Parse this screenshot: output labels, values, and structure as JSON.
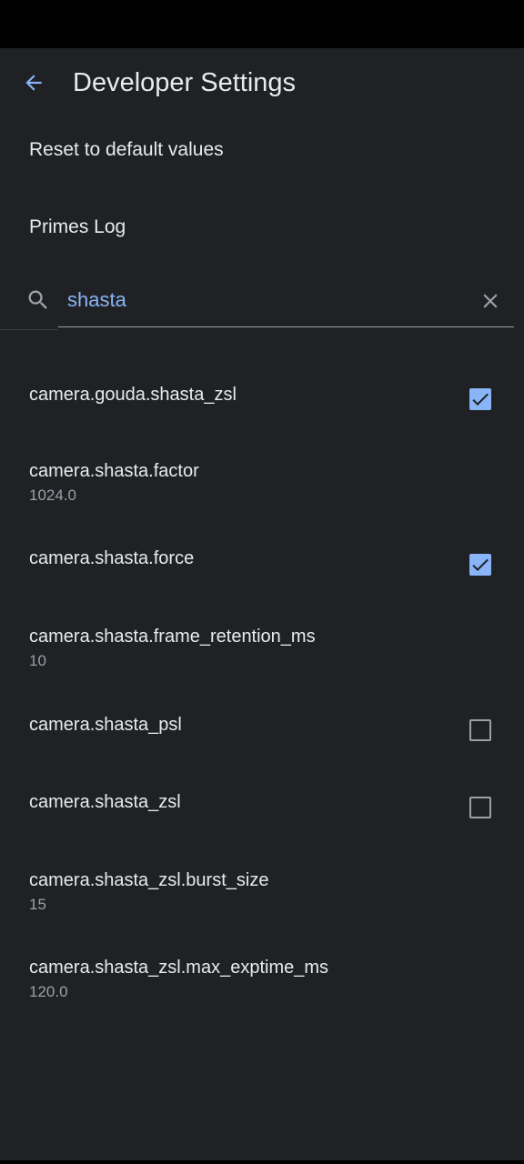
{
  "app_bar": {
    "title": "Developer Settings"
  },
  "menu": {
    "reset_label": "Reset to default values",
    "primes_log_label": "Primes Log"
  },
  "search": {
    "value": "shasta"
  },
  "settings": [
    {
      "title": "camera.gouda.shasta_zsl",
      "checkbox": "checked"
    },
    {
      "title": "camera.shasta.factor",
      "summary": "1024.0"
    },
    {
      "title": "camera.shasta.force",
      "checkbox": "checked"
    },
    {
      "title": "camera.shasta.frame_retention_ms",
      "summary": "10"
    },
    {
      "title": "camera.shasta_psl",
      "checkbox": "unchecked"
    },
    {
      "title": "camera.shasta_zsl",
      "checkbox": "unchecked"
    },
    {
      "title": "camera.shasta_zsl.burst_size",
      "summary": "15"
    },
    {
      "title": "camera.shasta_zsl.max_exptime_ms",
      "summary": "120.0"
    }
  ],
  "colors": {
    "background": "#202124",
    "accent": "#8ab4f8",
    "text_primary": "#e8eaed",
    "text_secondary": "#9aa0a6"
  },
  "icons": {
    "back": "arrow-back-icon",
    "search": "search-icon",
    "clear": "close-icon",
    "check": "check-icon"
  }
}
